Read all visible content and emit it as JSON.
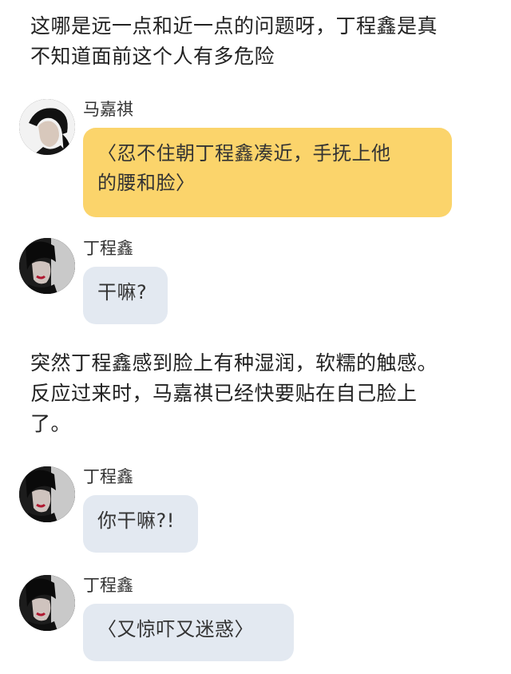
{
  "narration": {
    "intro_line1": "这哪是远一点和近一点的问题呀，丁程鑫是真",
    "intro_line2": "不知道面前这个人有多危险",
    "middle_line1": "突然丁程鑫感到脸上有种湿润，软糯的触感。",
    "middle_line2": "反应过来时，马嘉祺已经快要贴在自己脸上",
    "middle_line3": "了。"
  },
  "messages": [
    {
      "sender": "马嘉祺",
      "line1": "〈忍不住朝丁程鑫凑近，手抚上他",
      "line2": "的腰和脸〉",
      "bubble_color": "#fbd46b"
    },
    {
      "sender": "丁程鑫",
      "line1": "干嘛?",
      "bubble_color": "#e3e9f1"
    },
    {
      "sender": "丁程鑫",
      "line1": "你干嘛?!",
      "bubble_color": "#e3e9f1"
    },
    {
      "sender": "丁程鑫",
      "line1": "〈又惊吓又迷惑〉",
      "bubble_color": "#e3e9f1"
    }
  ]
}
